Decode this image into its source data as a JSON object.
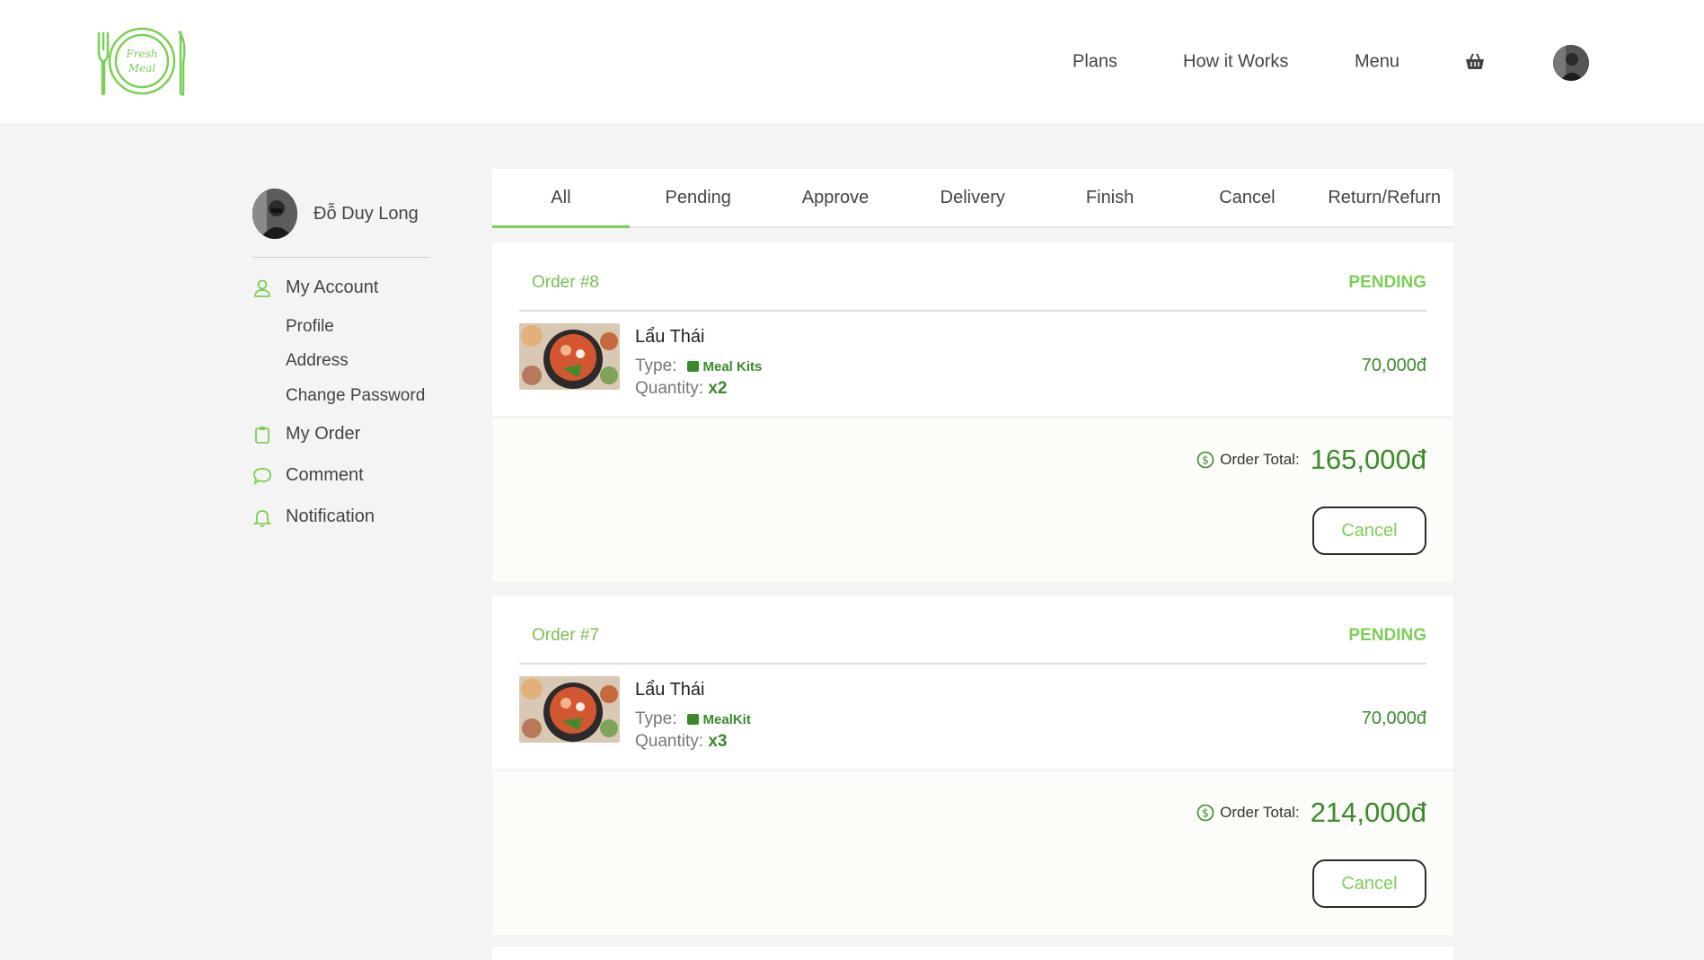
{
  "brand": {
    "logo_text_1": "Fresh",
    "logo_text_2": "Meal",
    "accent": "#7ccf55",
    "dark_green": "#3a8a2a"
  },
  "nav": {
    "plans": "Plans",
    "how_it_works": "How it Works",
    "menu": "Menu",
    "cart_icon": "basket-icon",
    "avatar_icon": "user-avatar"
  },
  "sidebar": {
    "user_name": "Đỗ Duy Long",
    "my_account": "My Account",
    "profile": "Profile",
    "address": "Address",
    "change_password": "Change Password",
    "my_order": "My Order",
    "comment": "Comment",
    "notification": "Notification"
  },
  "tabs": [
    "All",
    "Pending",
    "Approve",
    "Delivery",
    "Finish",
    "Cancel",
    "Return/Refurn"
  ],
  "active_tab": "All",
  "orders": [
    {
      "id": "Order #8",
      "status": "PENDING",
      "item_name": "Lẩu Thái",
      "type_label": "Type:",
      "type_value": "Meal Kits",
      "qty_label": "Quantity:",
      "qty_value": "x2",
      "price": "70,000đ",
      "total_label": "Order Total:",
      "total_value": "165,000đ",
      "cancel_label": "Cancel"
    },
    {
      "id": "Order #7",
      "status": "PENDING",
      "item_name": "Lẩu Thái",
      "type_label": "Type:",
      "type_value": "MealKit",
      "qty_label": "Quantity:",
      "qty_value": "x3",
      "price": "70,000đ",
      "total_label": "Order Total:",
      "total_value": "214,000đ",
      "cancel_label": "Cancel"
    }
  ]
}
